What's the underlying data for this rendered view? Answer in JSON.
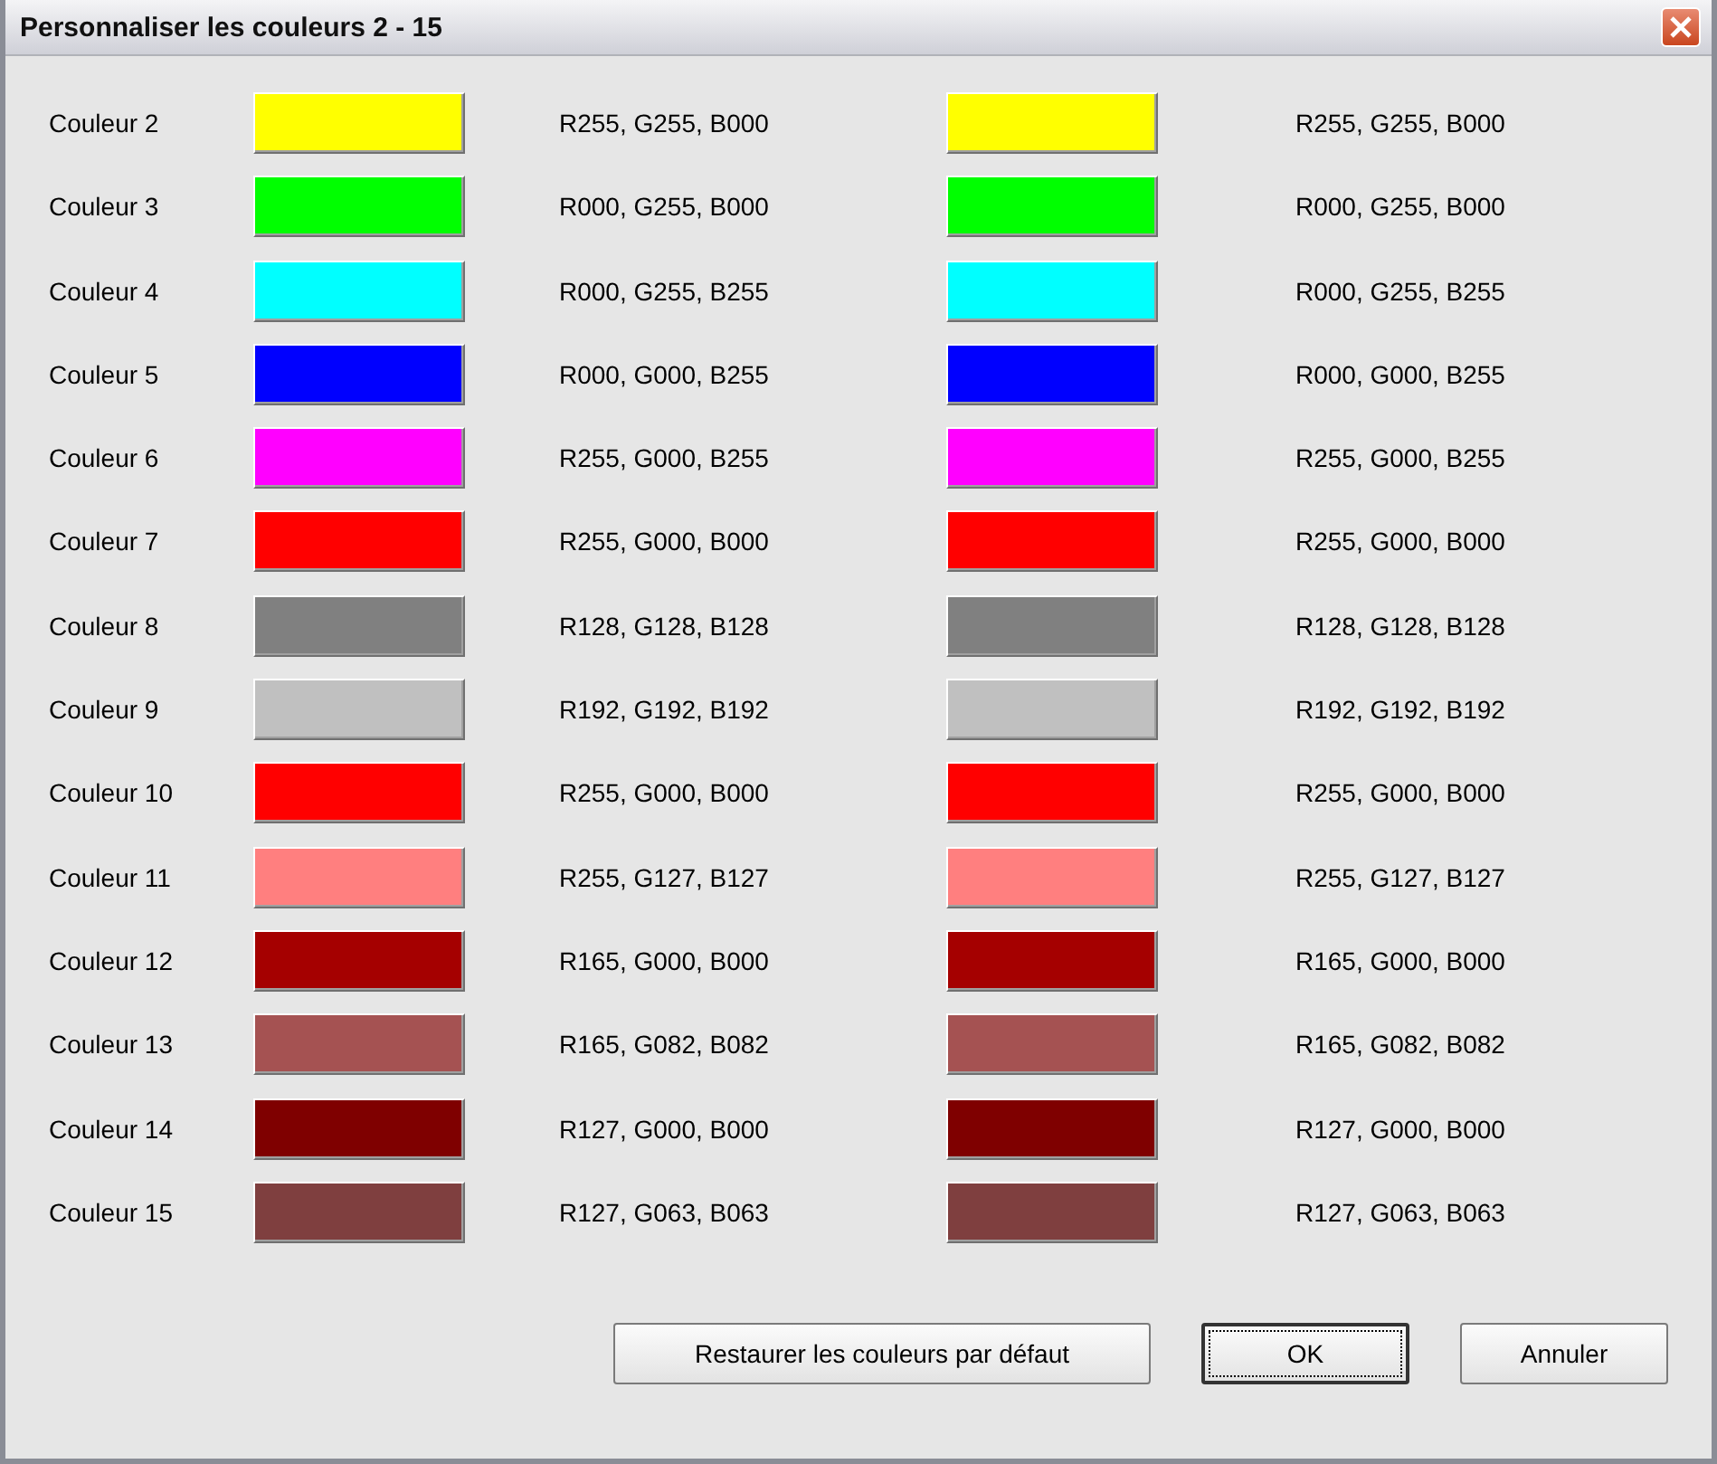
{
  "window": {
    "title": "Personnaliser les couleurs 2 - 15"
  },
  "rows": [
    {
      "label": "Couleur 2",
      "swatches": [
        {
          "color": "#ffff00",
          "reading": "R255, G255, B000"
        },
        {
          "color": "#ffff00",
          "reading": "R255, G255, B000"
        }
      ]
    },
    {
      "label": "Couleur 3",
      "swatches": [
        {
          "color": "#00ff00",
          "reading": "R000, G255, B000"
        },
        {
          "color": "#00ff00",
          "reading": "R000, G255, B000"
        }
      ]
    },
    {
      "label": "Couleur 4",
      "swatches": [
        {
          "color": "#00ffff",
          "reading": "R000, G255, B255"
        },
        {
          "color": "#00ffff",
          "reading": "R000, G255, B255"
        }
      ]
    },
    {
      "label": "Couleur 5",
      "swatches": [
        {
          "color": "#0000ff",
          "reading": "R000, G000, B255"
        },
        {
          "color": "#0000ff",
          "reading": "R000, G000, B255"
        }
      ]
    },
    {
      "label": "Couleur 6",
      "swatches": [
        {
          "color": "#ff00ff",
          "reading": "R255, G000, B255"
        },
        {
          "color": "#ff00ff",
          "reading": "R255, G000, B255"
        }
      ]
    },
    {
      "label": "Couleur 7",
      "swatches": [
        {
          "color": "#ff0000",
          "reading": "R255, G000, B000"
        },
        {
          "color": "#ff0000",
          "reading": "R255, G000, B000"
        }
      ]
    },
    {
      "label": "Couleur 8",
      "swatches": [
        {
          "color": "#808080",
          "reading": "R128, G128, B128"
        },
        {
          "color": "#808080",
          "reading": "R128, G128, B128"
        }
      ]
    },
    {
      "label": "Couleur 9",
      "swatches": [
        {
          "color": "#c0c0c0",
          "reading": "R192, G192, B192"
        },
        {
          "color": "#c0c0c0",
          "reading": "R192, G192, B192"
        }
      ]
    },
    {
      "label": "Couleur 10",
      "swatches": [
        {
          "color": "#ff0000",
          "reading": "R255, G000, B000"
        },
        {
          "color": "#ff0000",
          "reading": "R255, G000, B000"
        }
      ]
    },
    {
      "label": "Couleur 11",
      "swatches": [
        {
          "color": "#ff7f7f",
          "reading": "R255, G127, B127"
        },
        {
          "color": "#ff7f7f",
          "reading": "R255, G127, B127"
        }
      ]
    },
    {
      "label": "Couleur 12",
      "swatches": [
        {
          "color": "#a50000",
          "reading": "R165, G000, B000"
        },
        {
          "color": "#a50000",
          "reading": "R165, G000, B000"
        }
      ]
    },
    {
      "label": "Couleur 13",
      "swatches": [
        {
          "color": "#a55252",
          "reading": "R165, G082, B082"
        },
        {
          "color": "#a55252",
          "reading": "R165, G082, B082"
        }
      ]
    },
    {
      "label": "Couleur 14",
      "swatches": [
        {
          "color": "#7f0000",
          "reading": "R127, G000, B000"
        },
        {
          "color": "#7f0000",
          "reading": "R127, G000, B000"
        }
      ]
    },
    {
      "label": "Couleur 15",
      "swatches": [
        {
          "color": "#7f3f3f",
          "reading": "R127, G063, B063"
        },
        {
          "color": "#7f3f3f",
          "reading": "R127, G063, B063"
        }
      ]
    }
  ],
  "buttons": [
    {
      "label": "Restaurer les couleurs par défaut",
      "focused": false
    },
    {
      "label": "OK",
      "focused": true
    },
    {
      "label": "Annuler",
      "focused": false
    }
  ]
}
